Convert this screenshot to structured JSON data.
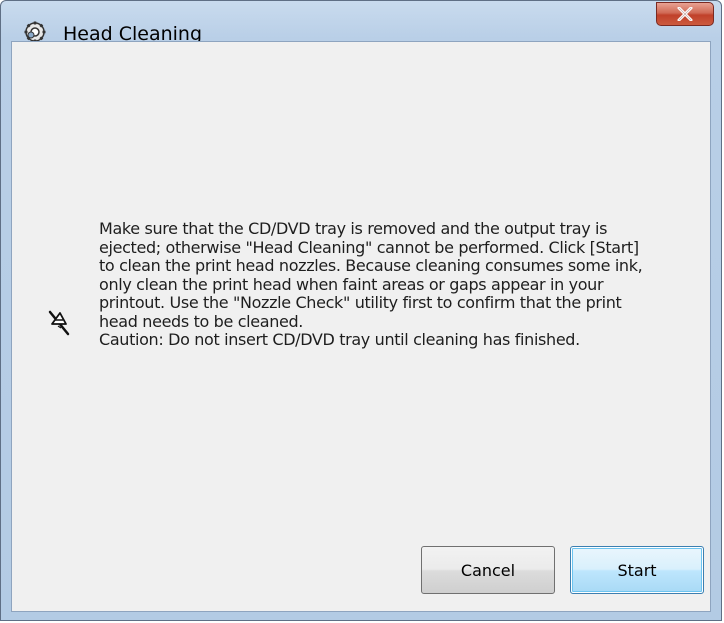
{
  "window": {
    "title": "Head Cleaning",
    "icon": "printer-gear-icon",
    "close_icon": "close-icon"
  },
  "message": {
    "text": "Make sure that the CD/DVD tray is removed and the output tray is\nejected; otherwise \"Head Cleaning\" cannot be performed. Click [Start]\nto clean the print head nozzles. Because cleaning consumes some ink,\nonly clean the print head when faint areas or gaps appear in your\nprintout. Use the \"Nozzle Check\" utility first to confirm that the print\nhead needs to be cleaned.\nCaution: Do not insert CD/DVD tray until cleaning has finished.",
    "side_icon": "print-head-icon"
  },
  "buttons": {
    "cancel_label": "Cancel",
    "start_label": "Start"
  },
  "colors": {
    "close_button": "#c7472f",
    "start_button_border": "#3c7fb1",
    "window_frame": "#b3cbe4",
    "client_background": "#f0f0f0"
  }
}
